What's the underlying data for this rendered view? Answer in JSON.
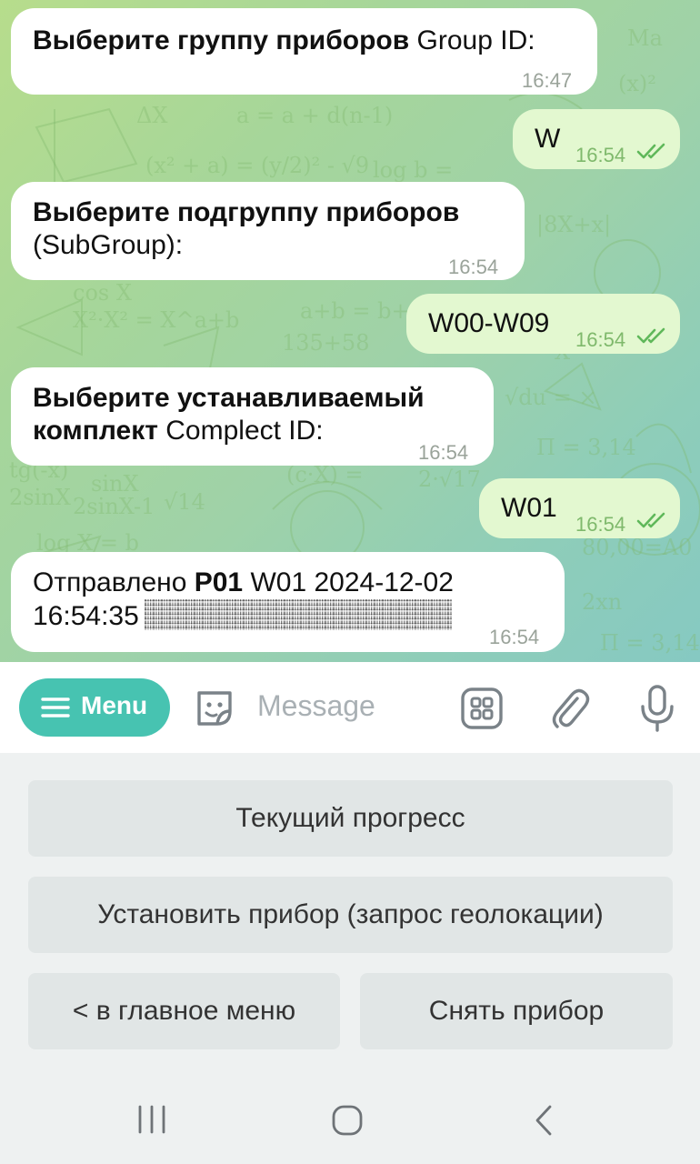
{
  "messages": [
    {
      "dir": "in",
      "bold": "Выберите группу приборов",
      "rest": " Group ID:",
      "time": "16:47"
    },
    {
      "dir": "out",
      "text": "W",
      "time": "16:54"
    },
    {
      "dir": "in",
      "bold": "Выберите подгруппу приборов",
      "line2": "(SubGroup):",
      "time": "16:54"
    },
    {
      "dir": "out",
      "text": "W00-W09",
      "time": "16:54"
    },
    {
      "dir": "in",
      "line1": "Выберите устанавливаемый",
      "line2_bold": "комплект",
      "line2_rest": " Complect ID:",
      "time": "16:54"
    },
    {
      "dir": "out",
      "text": "W01",
      "time": "16:54"
    },
    {
      "dir": "in",
      "line1_a": "Отправлено ",
      "line1_bold": "P01",
      "line1_b": " W01 2024-12-02",
      "line2": "16:54:35",
      "time": "16:54"
    }
  ],
  "input": {
    "menu_label": "Menu",
    "placeholder": "Message"
  },
  "keyboard": {
    "row1": "Текущий прогресс",
    "row2": "Установить прибор (запрос геолокации)",
    "row3_left": "< в главное меню",
    "row3_right": "Снять прибор"
  },
  "icons": [
    "emoji-sticker-icon",
    "bot-commands-icon",
    "attach-icon",
    "microphone-icon",
    "read-ticks-icon",
    "recent-apps-icon",
    "home-icon",
    "back-icon"
  ],
  "colors": {
    "accent": "#47c3b1",
    "outgoing_bubble": "#e3f8d0",
    "incoming_bubble": "#ffffff",
    "tick": "#5fb85a"
  }
}
